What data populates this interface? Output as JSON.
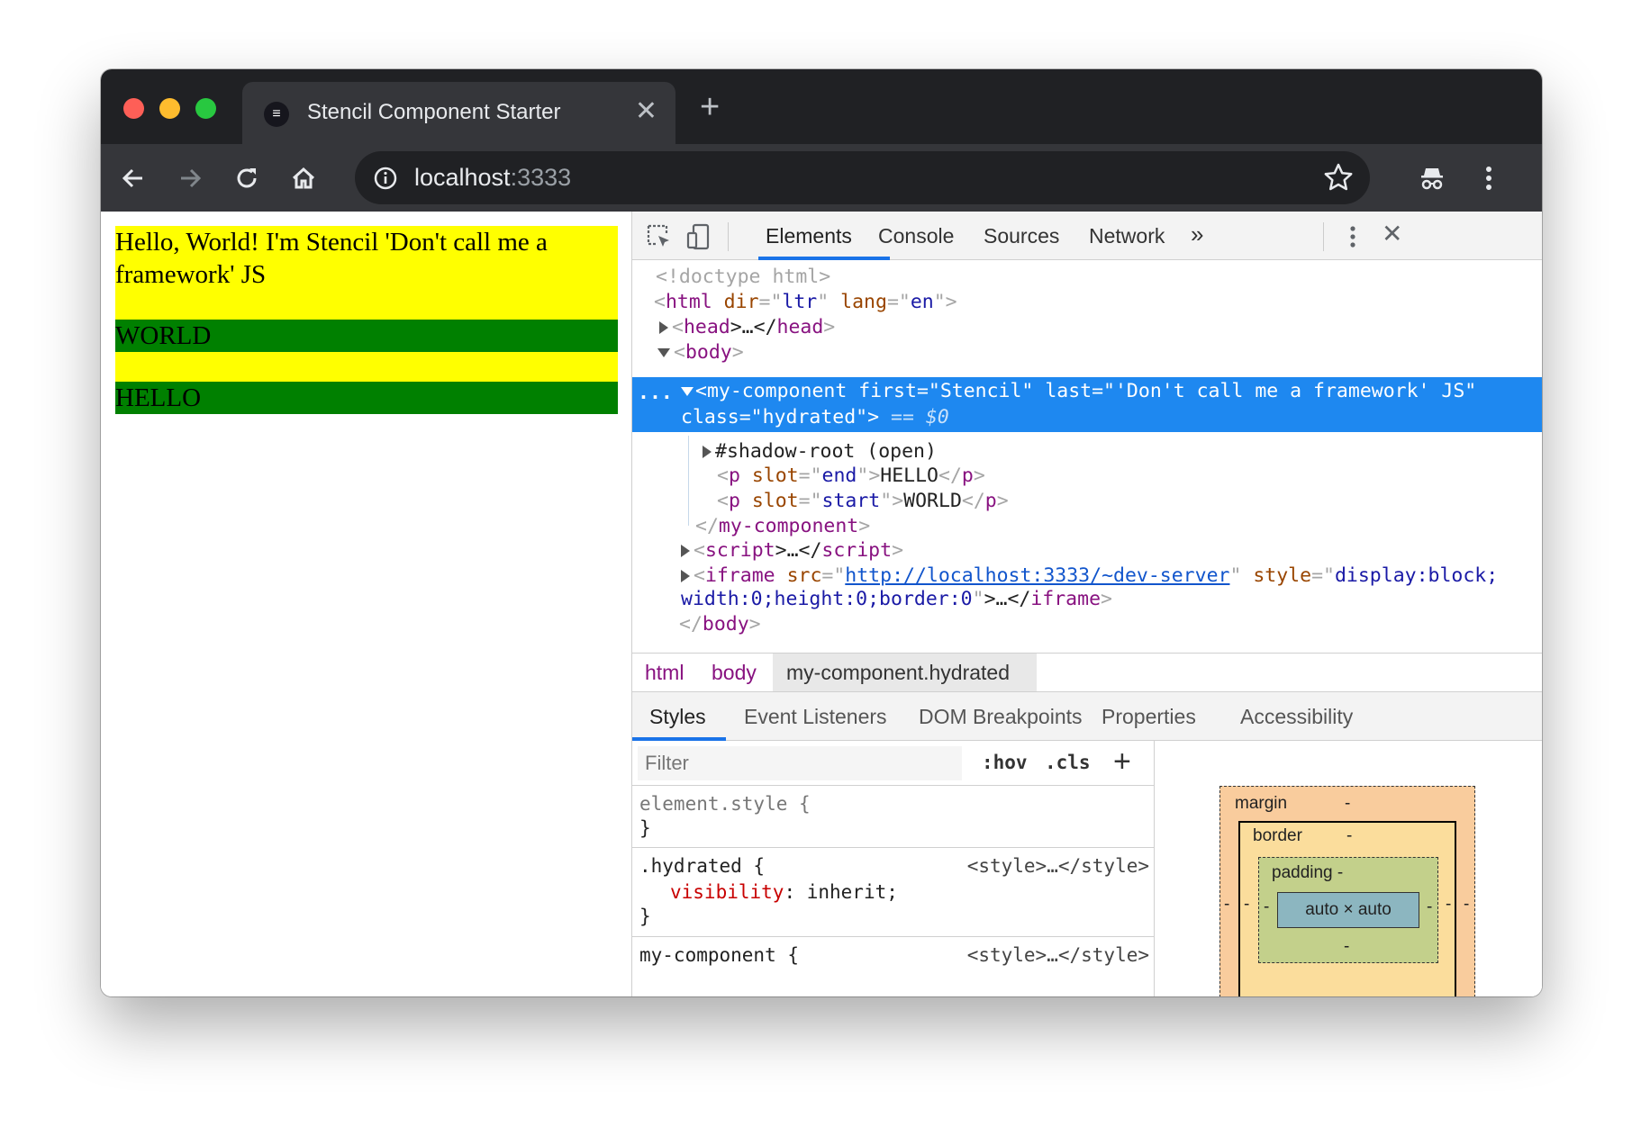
{
  "browser": {
    "tab_title": "Stencil Component Starter",
    "tab_close": "✕",
    "new_tab": "+",
    "url_host": "localhost",
    "url_port": ":3333"
  },
  "page": {
    "heading": "Hello, World! I'm Stencil 'Don't call me a framework' JS",
    "world": "WORLD",
    "hello": "HELLO"
  },
  "devtools": {
    "tabs": [
      "Elements",
      "Console",
      "Sources",
      "Network"
    ],
    "more_tabs": "»",
    "close": "✕",
    "dom": {
      "doctype": "<!doctype html>",
      "html_open": [
        "<",
        "html",
        " dir",
        "=\"",
        "ltr",
        "\"",
        " lang",
        "=\"",
        "en",
        "\"",
        ">"
      ],
      "head": [
        "<",
        "head",
        ">…</",
        "head",
        ">"
      ],
      "body_open": [
        "<",
        "body",
        ">"
      ],
      "ellipsis": "...",
      "sel_line1": "<my-component first=\"Stencil\" last=\"'Don't call me a framework' JS\"",
      "sel_line2": "class=\"hydrated\">",
      "sel_eq": " == $0",
      "shadow_root": "#shadow-root (open)",
      "p_end": [
        "<",
        "p",
        " slot",
        "=\"",
        "end",
        "\"",
        ">",
        "HELLO",
        "</",
        "p",
        ">"
      ],
      "p_start": [
        "<",
        "p",
        " slot",
        "=\"",
        "start",
        "\"",
        ">",
        "WORLD",
        "</",
        "p",
        ">"
      ],
      "mc_close": [
        "</",
        "my-component",
        ">"
      ],
      "script": [
        "<",
        "script",
        ">…</",
        "script",
        ">"
      ],
      "iframe_a": [
        "<",
        "iframe",
        " src",
        "=\"",
        "http://localhost:3333/~dev-server",
        "\"",
        " style",
        "=\"",
        "display:block;"
      ],
      "iframe_b": [
        "width:0;height:0;border:0",
        "\"",
        ">…</",
        "iframe",
        ">"
      ],
      "body_close": [
        "</",
        "body",
        ">"
      ]
    },
    "breadcrumbs": [
      "html",
      "body",
      "my-component.hydrated"
    ],
    "subtabs": [
      "Styles",
      "Event Listeners",
      "DOM Breakpoints",
      "Properties",
      "Accessibility"
    ],
    "styles": {
      "filter_placeholder": "Filter",
      "hov": ":hov",
      "cls": ".cls",
      "add": "+",
      "element_style": "element.style {",
      "close_brace": "}",
      "hydrated_selector": ".hydrated {",
      "hydrated_source": "<style>…</style>",
      "visibility_prop": "visibility",
      "visibility_value": ": inherit;",
      "mycomp_selector": "my-component {",
      "mycomp_source": "<style>…</style>"
    },
    "boxmodel": {
      "margin_label": "margin",
      "margin_val": "-",
      "border_label": "border",
      "border_val": "-",
      "padding_label": "padding -",
      "content": "auto × auto",
      "dash": "-"
    }
  }
}
